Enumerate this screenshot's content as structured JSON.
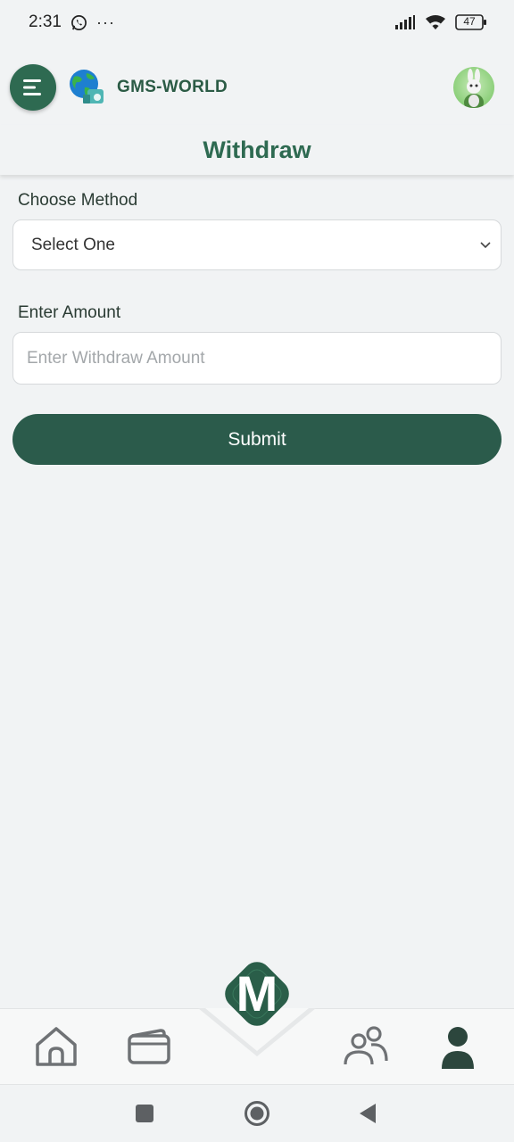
{
  "status_bar": {
    "time": "2:31",
    "dots": "···",
    "battery": "47"
  },
  "header": {
    "brand": "GMS-WORLD"
  },
  "page": {
    "title": "Withdraw"
  },
  "form": {
    "method_label": "Choose Method",
    "method_selected": "Select One",
    "amount_label": "Enter Amount",
    "amount_placeholder": "Enter Withdraw Amount",
    "amount_value": "",
    "submit_label": "Submit"
  },
  "center_button": {
    "letter": "M"
  },
  "bottom_nav": {
    "items": [
      {
        "icon": "home-icon",
        "active": false
      },
      {
        "icon": "wallet-icon",
        "active": false
      },
      {
        "icon": "team-icon",
        "active": false
      },
      {
        "icon": "profile-icon",
        "active": true
      }
    ]
  },
  "colors": {
    "accent": "#2e6a51",
    "button": "#2b5b4b",
    "background": "#f1f3f4"
  }
}
